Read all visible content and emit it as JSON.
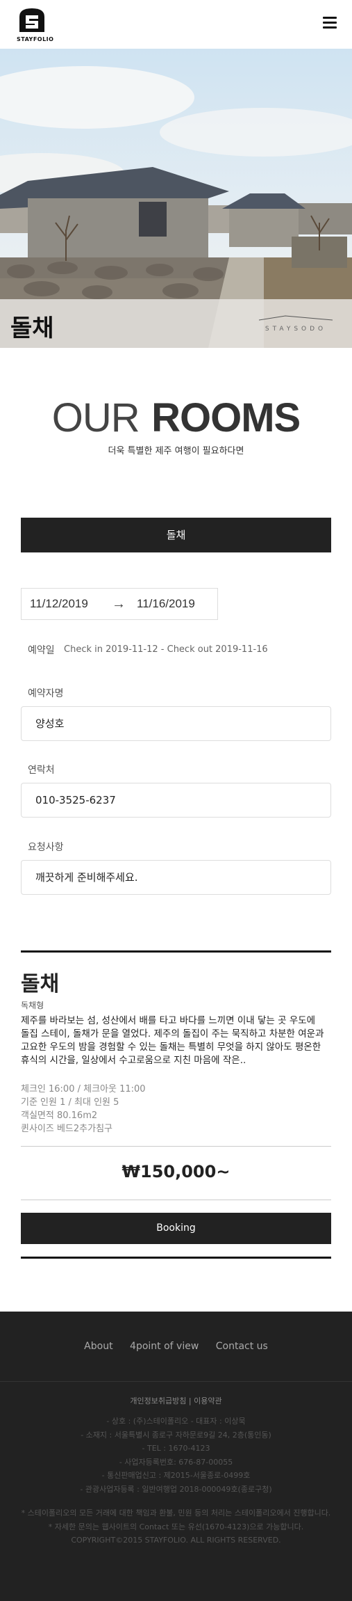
{
  "header": {
    "logo_text": "STAYFOLIO",
    "menu_icon": "hamburger-menu-icon"
  },
  "hero": {
    "title": "돌채",
    "brand": "STAYSODO"
  },
  "rooms": {
    "title_thin": "OUR",
    "title_bold": "ROOMS",
    "subtitle": "더욱 특별한 제주 여행이 필요하다면"
  },
  "room_banner": "돌채",
  "dates": {
    "check_in": "11/12/2019",
    "arrow": "→",
    "check_out": "11/16/2019"
  },
  "reservation": {
    "label": "예약일",
    "value": "Check in 2019-11-12 - Check out 2019-11-16"
  },
  "form": {
    "name_label": "예약자명",
    "name_value": "양성호",
    "phone_label": "연락처",
    "phone_value": "010-3525-6237",
    "request_label": "요청사항",
    "request_value": "깨끗하게 준비해주세요."
  },
  "room": {
    "name": "돌채",
    "type": "독채형",
    "description": "제주를 바라보는 섬, 성산에서 배를 타고 바다를 느끼면 이내 닿는 곳 우도에 돌집 스테이, 돌채가 문을 열었다. 제주의 돌집이 주는 묵직하고 차분한 여운과 고요한 우도의 밤을 경험할 수 있는 돌채는 특별히 무엇을 하지 않아도 평온한 휴식의 시간을, 일상에서 수고로움으로 지친 마음에 작은..",
    "info": [
      "체크인 16:00 / 체크아웃 11:00",
      "기준 인원 1 / 최대 인원 5",
      "객실면적 80.16m2",
      "퀸사이즈 베드2추가침구"
    ],
    "price": "₩150,000~",
    "booking_label": "Booking"
  },
  "footer": {
    "nav": [
      "About",
      "4point of view",
      "Contact us"
    ],
    "policy": "개인정보취급방침 | 이용약관",
    "info": [
      "- 상호 : (주)스테이폴리오 - 대표자 : 이상묵",
      "- 소재지 : 서울특별시 종로구 자하문로9길 24, 2층(통인동)",
      "- TEL : 1670-4123",
      "- 사업자등록번호: 676-87-00055",
      "- 통신판매업신고 : 제2015-서울종로-0499호",
      "- 관광사업자등록 : 일반여행업 2018-000049호(종로구청)"
    ],
    "notes": [
      "* 스테이폴리오의 모든 거래에 대한 책임과 환불, 민원 등의 처리는 스테이폴리오에서 진행합니다.",
      "* 자세한 문의는 웹사이트의 Contact 또는 유선(1670-4123)으로 가능합니다.",
      "COPYRIGHT©2015 STAYFOLIO. ALL RIGHTS RESERVED."
    ]
  }
}
